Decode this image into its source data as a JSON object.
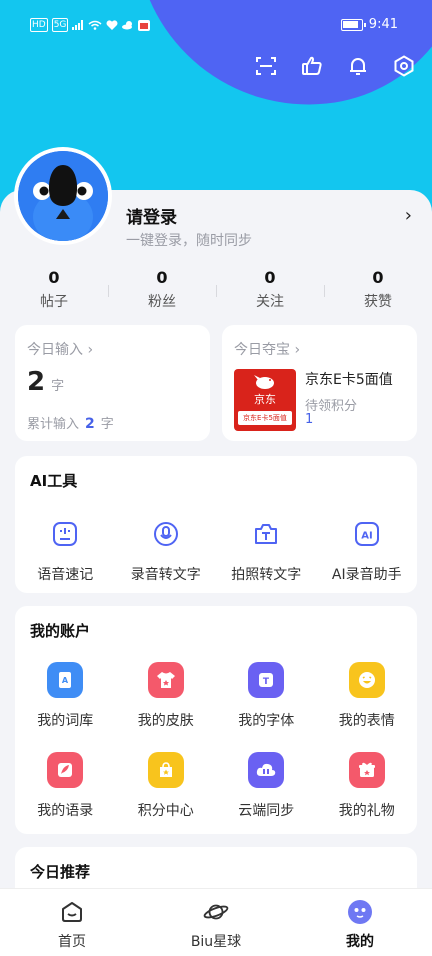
{
  "status_bar": {
    "left_labels": [
      "HD",
      "5G"
    ],
    "time": "9:41"
  },
  "profile": {
    "name": "请登录",
    "subtitle": "一键登录，随时同步",
    "chevron": "›"
  },
  "stats": [
    {
      "value": "0",
      "label": "帖子"
    },
    {
      "value": "0",
      "label": "粉丝"
    },
    {
      "value": "0",
      "label": "关注"
    },
    {
      "value": "0",
      "label": "获赞"
    }
  ],
  "today_input": {
    "title": "今日输入 ›",
    "count": "2",
    "unit": "字",
    "total_prefix": "累计输入",
    "total_value": "2",
    "total_unit": "字"
  },
  "today_treasure": {
    "title": "今日夺宝 ›",
    "product": "京东E卡5面值",
    "status": "待领积分",
    "points": "1",
    "card_brand": "京东",
    "card_text": "京东E卡5面值"
  },
  "ai_tools": {
    "title": "AI工具",
    "items": [
      {
        "label": "语音速记",
        "icon": "voice-note-icon"
      },
      {
        "label": "录音转文字",
        "icon": "record-to-text-icon"
      },
      {
        "label": "拍照转文字",
        "icon": "photo-to-text-icon"
      },
      {
        "label": "AI录音助手",
        "icon": "ai-recorder-icon"
      }
    ]
  },
  "account": {
    "title": "我的账户",
    "items": [
      {
        "label": "我的词库",
        "icon": "lexicon-icon",
        "color": "#3f8df5"
      },
      {
        "label": "我的皮肤",
        "icon": "skin-icon",
        "color": "#f4596b"
      },
      {
        "label": "我的字体",
        "icon": "font-icon",
        "color": "#6a61f2"
      },
      {
        "label": "我的表情",
        "icon": "emoji-icon",
        "color": "#f8c41d"
      },
      {
        "label": "我的语录",
        "icon": "quotes-icon",
        "color": "#f4596b"
      },
      {
        "label": "积分中心",
        "icon": "points-icon",
        "color": "#f8c41d"
      },
      {
        "label": "云端同步",
        "icon": "cloud-sync-icon",
        "color": "#6a61f2"
      },
      {
        "label": "我的礼物",
        "icon": "gift-icon",
        "color": "#f4596b"
      }
    ]
  },
  "recommend": {
    "title": "今日推荐"
  },
  "tabbar": [
    {
      "label": "首页",
      "icon": "home-icon"
    },
    {
      "label": "Biu星球",
      "icon": "planet-icon"
    },
    {
      "label": "我的",
      "icon": "me-icon",
      "active": true
    }
  ],
  "colors": {
    "hero_cyan": "#13c6ef",
    "hero_blue": "#4f64f3",
    "accent": "#4661e8"
  }
}
